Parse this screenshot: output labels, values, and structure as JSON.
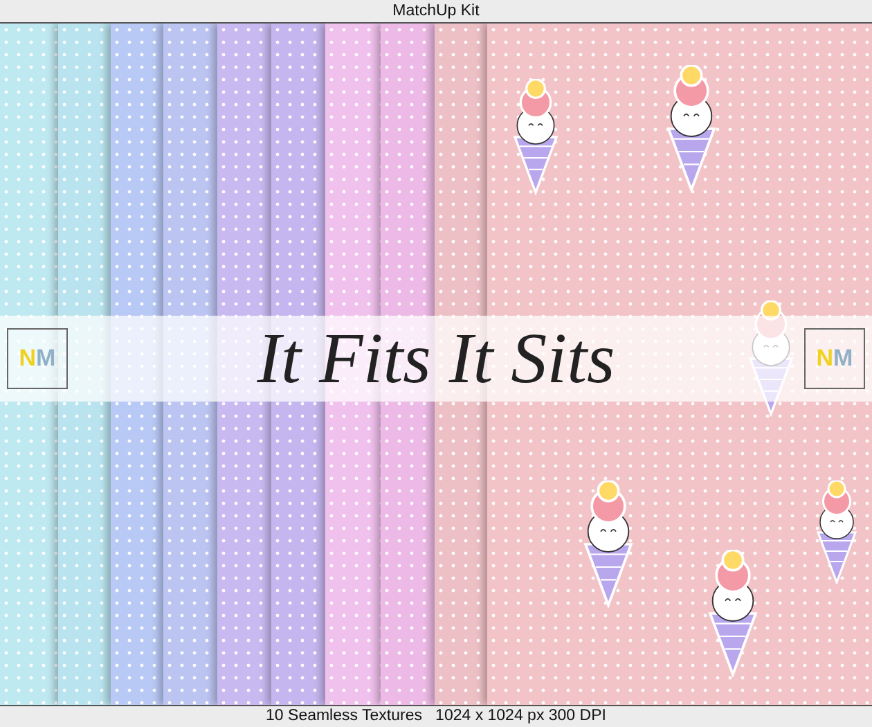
{
  "window": {
    "title": "MatchUp Kit"
  },
  "textures": [
    {
      "color": "#bfe9f1"
    },
    {
      "color": "#b9e3ee"
    },
    {
      "color": "#b9c9f5"
    },
    {
      "color": "#bcc5f2"
    },
    {
      "color": "#c9b9f1"
    },
    {
      "color": "#c6b6ef"
    },
    {
      "color": "#f1c1ee"
    },
    {
      "color": "#edb9e6"
    },
    {
      "color": "#edc0c6"
    },
    {
      "color": "#f2c4c8"
    }
  ],
  "banner": {
    "logos": [
      "NM",
      "NM"
    ],
    "title": "It Fits It Sits"
  },
  "status_bar": "10 Seamless Textures   1024 x 1024 px 300 DPI"
}
